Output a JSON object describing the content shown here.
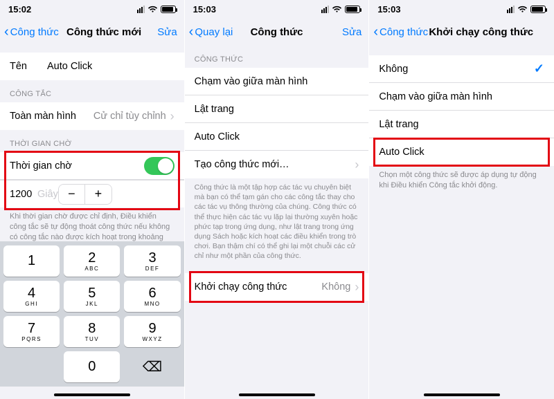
{
  "phone1": {
    "time": "15:02",
    "nav": {
      "back": "Công thức",
      "title": "Công thức mới",
      "edit": "Sửa"
    },
    "name_label": "Tên",
    "name_value": "Auto Click",
    "section_switch": "CÔNG TẮC",
    "switch_row": {
      "label": "Toàn màn hình",
      "value": "Cử chỉ tùy chỉnh"
    },
    "section_wait": "THỜI GIAN CHỜ",
    "wait_label": "Thời gian chờ",
    "seconds_value": "1200",
    "seconds_unit": "Giây",
    "wait_note": "Khi thời gian chờ được chỉ định, Điều khiển công tắc sẽ tự động thoát công thức nếu không có công tắc nào được kích hoạt trong khoảng thời gian chờ.",
    "keypad": {
      "r1": [
        [
          "1",
          ""
        ],
        [
          "2",
          "ABC"
        ],
        [
          "3",
          "DEF"
        ]
      ],
      "r2": [
        [
          "4",
          "GHI"
        ],
        [
          "5",
          "JKL"
        ],
        [
          "6",
          "MNO"
        ]
      ],
      "r3": [
        [
          "7",
          "PQRS"
        ],
        [
          "8",
          "TUV"
        ],
        [
          "9",
          "WXYZ"
        ]
      ],
      "r4_mid": [
        "0",
        ""
      ]
    }
  },
  "phone2": {
    "time": "15:03",
    "nav": {
      "back": "Quay lại",
      "title": "Công thức",
      "edit": "Sửa"
    },
    "section": "CÔNG THỨC",
    "items": [
      "Chạm vào giữa màn hình",
      "Lật trang",
      "Auto Click",
      "Tạo công thức mới…"
    ],
    "paragraph": "Công thức là một tập hợp các tác vụ chuyên biệt mà bạn có thể tạm gán cho các công tắc thay cho các tác vụ thông thường của chúng. Công thức có thể thực hiện các tác vụ lặp lại thường xuyên hoặc phức tạp trong ứng dụng, như lật trang trong ứng dụng Sách hoặc kích hoạt các điều khiển trong trò chơi. Bạn thậm chí có thể ghi lại một chuỗi các cử chỉ như một phần của công thức.",
    "launch": {
      "label": "Khởi chạy công thức",
      "value": "Không"
    }
  },
  "phone3": {
    "time": "15:03",
    "nav": {
      "back": "Công thức",
      "title": "Khởi chạy công thức"
    },
    "options": [
      "Không",
      "Chạm vào giữa màn hình",
      "Lật trang",
      "Auto Click"
    ],
    "selected_index": 0,
    "note": "Chọn một công thức sẽ được áp dụng tự động khi Điều khiển Công tắc khởi động."
  }
}
